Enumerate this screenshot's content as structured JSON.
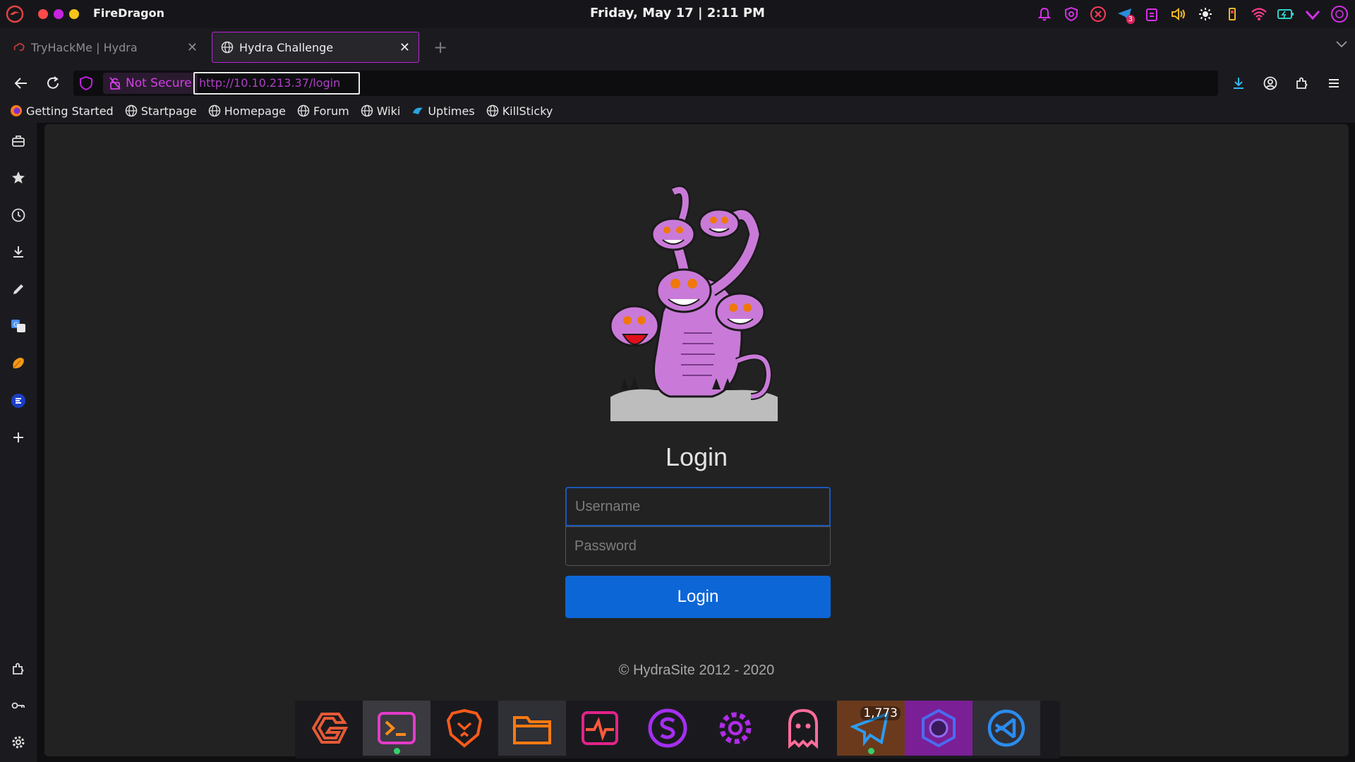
{
  "system": {
    "app_name": "FireDragon",
    "clock": "Friday, May 17 | 2:11 PM",
    "tray_badge": "3",
    "colors": {
      "close": "#ff4a4a",
      "min": "#c724e0",
      "max": "#f5c518",
      "accent": "#c021e0"
    }
  },
  "tabs": [
    {
      "label": "TryHackMe | Hydra",
      "icon": "tryhackme-icon",
      "active": false
    },
    {
      "label": "Hydra Challenge",
      "icon": "globe-icon",
      "active": true
    }
  ],
  "navbar": {
    "not_secure_label": "Not Secure",
    "url": "http://10.10.213.37/login"
  },
  "bookmarks": [
    {
      "label": "Getting Started",
      "icon": "firefox-icon"
    },
    {
      "label": "Startpage",
      "icon": "globe-icon"
    },
    {
      "label": "Homepage",
      "icon": "globe-icon"
    },
    {
      "label": "Forum",
      "icon": "globe-icon"
    },
    {
      "label": "Wiki",
      "icon": "globe-icon"
    },
    {
      "label": "Uptimes",
      "icon": "uptimes-icon"
    },
    {
      "label": "KillSticky",
      "icon": "globe-icon"
    }
  ],
  "page": {
    "title": "Login",
    "username_placeholder": "Username",
    "password_placeholder": "Password",
    "button_label": "Login",
    "footer": "© HydraSite 2012 - 2020"
  },
  "dock": {
    "badge_count": "1,773",
    "apps": [
      "garuda-icon",
      "terminal-icon",
      "brave-icon",
      "files-icon",
      "system-monitor-icon",
      "steam-s-icon",
      "settings-icon",
      "ghost-icon",
      "telegram-icon",
      "hydra-app-icon",
      "vscodium-icon"
    ]
  }
}
